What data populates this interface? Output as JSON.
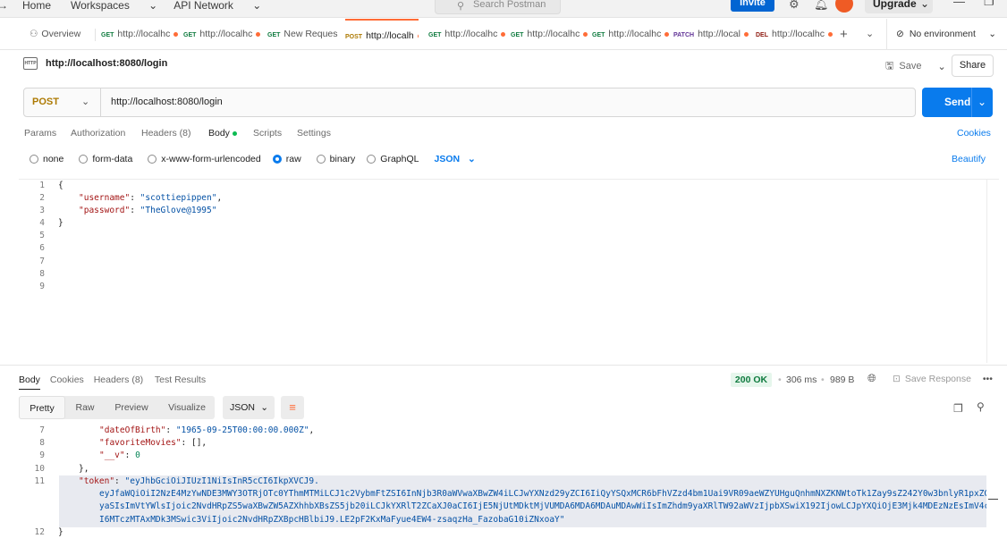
{
  "topbar": {
    "nav": [
      "Home",
      "Workspaces",
      "API Network"
    ],
    "search_placeholder": "Search Postman",
    "invite_label": "Invite",
    "upgrade_label": "Upgrade"
  },
  "tabs": [
    {
      "method": "",
      "label": "Overview"
    },
    {
      "method": "GET",
      "label": "http://localhc"
    },
    {
      "method": "GET",
      "label": "http://localhc"
    },
    {
      "method": "GET",
      "label": "New Reques"
    },
    {
      "method": "POST",
      "label": "http://localh"
    },
    {
      "method": "GET",
      "label": "http://localhc"
    },
    {
      "method": "GET",
      "label": "http://localhc"
    },
    {
      "method": "GET",
      "label": "http://localhc"
    },
    {
      "method": "PATCH",
      "label": "http://local"
    },
    {
      "method": "DEL",
      "label": "http://localhc"
    }
  ],
  "environment": "No environment",
  "request": {
    "title": "http://localhost:8080/login",
    "save_label": "Save",
    "share_label": "Share",
    "method": "POST",
    "url": "http://localhost:8080/login",
    "send_label": "Send",
    "subtabs": [
      "Params",
      "Authorization",
      "Headers (8)",
      "Body",
      "Scripts",
      "Settings"
    ],
    "cookies_label": "Cookies",
    "body_types": [
      "none",
      "form-data",
      "x-www-form-urlencoded",
      "raw",
      "binary",
      "GraphQL"
    ],
    "body_format": "JSON",
    "beautify_label": "Beautify",
    "body_lines": [
      "1",
      "2",
      "3",
      "4",
      "5",
      "6",
      "7",
      "8",
      "9"
    ],
    "body": {
      "open": "{",
      "username_key": "\"username\"",
      "username_val": "\"scottiepippen\"",
      "password_key": "\"password\"",
      "password_val": "\"TheGlove@1995\"",
      "close": "}"
    }
  },
  "response": {
    "tabs": [
      "Body",
      "Cookies",
      "Headers (8)",
      "Test Results"
    ],
    "status": "200 OK",
    "time": "306 ms",
    "size": "989 B",
    "save_response": "Save Response",
    "views": [
      "Pretty",
      "Raw",
      "Preview",
      "Visualize"
    ],
    "format": "JSON",
    "lines": {
      "l7": "7",
      "l8": "8",
      "l9": "9",
      "l10": "10",
      "l11": "11",
      "l12": "12",
      "dob_key": "\"dateOfBirth\"",
      "dob_val": "\"1965-09-25T00:00:00.000Z\"",
      "fav_key": "\"favoriteMovies\"",
      "fav_val": "[],",
      "v_key": "\"__v\"",
      "v_val": "0",
      "close_obj": "},",
      "token_key": "\"token\"",
      "token_1": "\"eyJhbGciOiJIUzI1NiIsInR5cCI6IkpXVCJ9.",
      "token_2": "eyJfaWQiOiI2NzE4MzYwNDE3MWY3OTRjOTc0YThmMTMiLCJ1c2VybmFtZSI6InNjb3R0aWVwaXBwZW4iLCJwYXNzd29yZCI6IiQyYSQxMCR6bFhVZzd4bm1Uai9VR09aeWZYUHguQnhmNXZKNWtoTk1Zay9sZ242Y0w3bnlyR1pxZGU",
      "token_3": "yaSIsImVtYWlsIjoic2NvdHRpZS5waXBwZW5AZXhhbXBsZS5jb20iLCJkYXRlT2ZCaXJ0aCI6IjE5NjUtMDktMjVUMDA6MDA6MDAuMDAwWiIsImZhdm9yaXRlTW92aWVzIjpbXSwiX192IjowLCJpYXQiOjE3Mjk4MDEzNzEsImV4cC",
      "token_4": "I6MTczMTAxMDk3MSwic3ViIjoic2NvdHRpZXBpcHBlbiJ9.LE2pF2KxMaFyue4EW4-zsaqzHa_FazobaG10iZNxoaY\"",
      "close_root": "}"
    }
  },
  "colors": {
    "accent": "#ff6c37",
    "primary": "#097bed",
    "post": "#ad7a03",
    "get": "#0f7b3f"
  }
}
